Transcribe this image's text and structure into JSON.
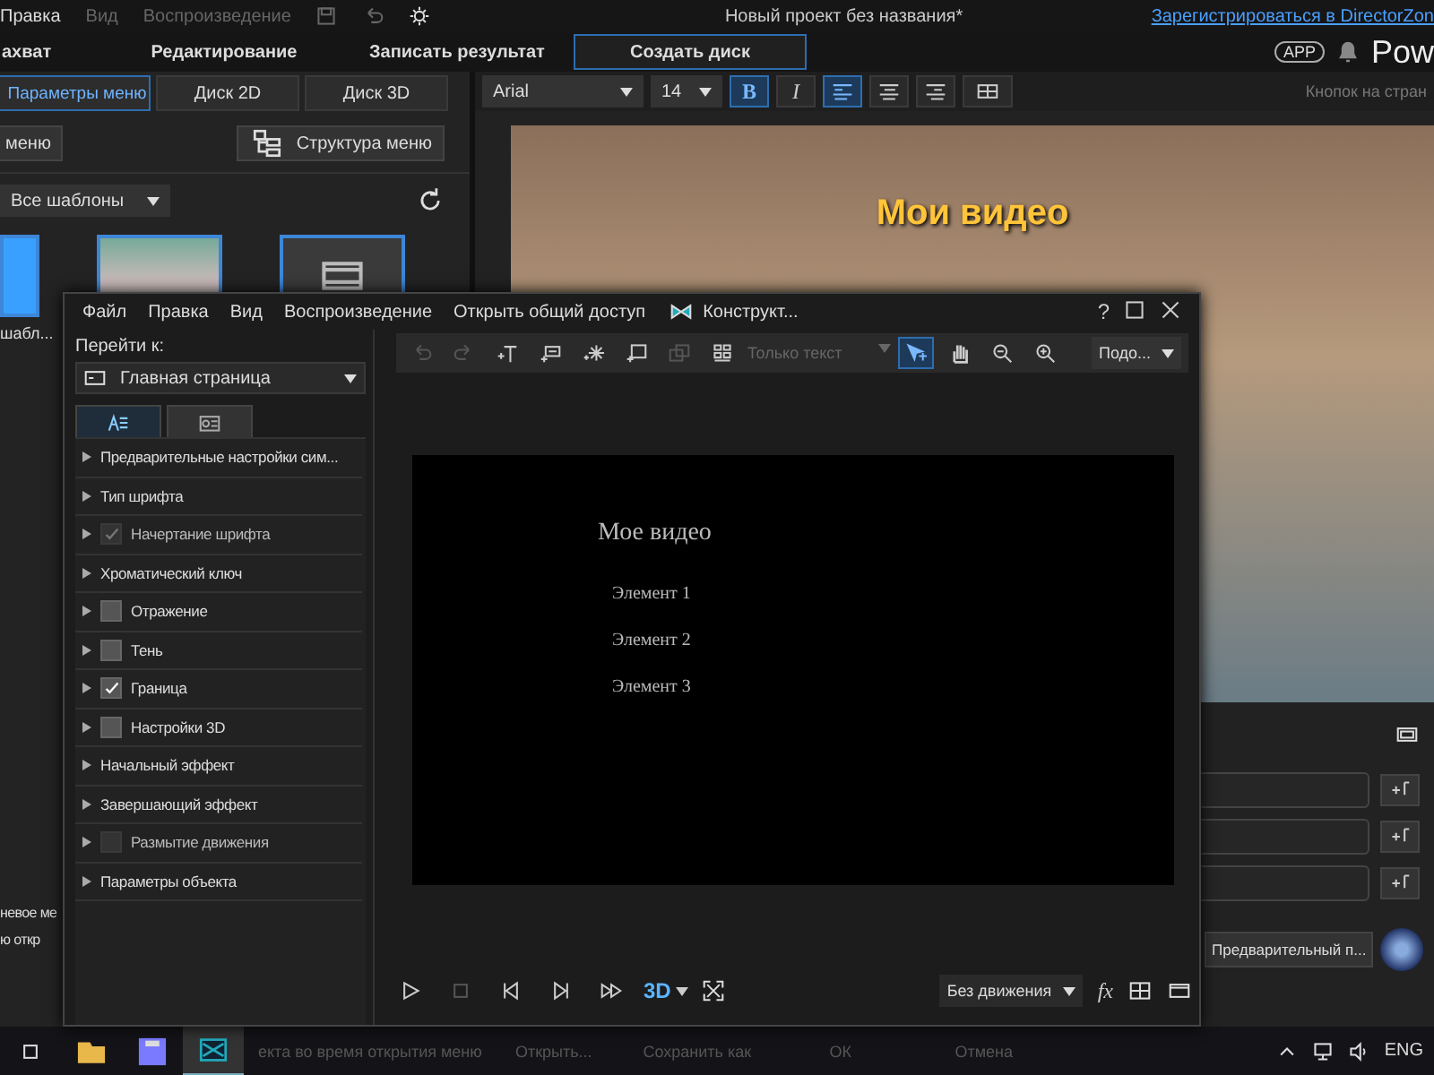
{
  "app": {
    "menu": [
      "Правка",
      "Вид",
      "Воспроизведение"
    ],
    "title": "Новый проект без названия*",
    "register_link": "Зарегистрироваться в DirectorZon",
    "app_badge": "APP",
    "brand": "Pow",
    "tabs": [
      {
        "label": "ахват",
        "selected": false
      },
      {
        "label": "Редактирование",
        "selected": false
      },
      {
        "label": "Записать результат",
        "selected": false
      },
      {
        "label": "Создать диск",
        "selected": true
      }
    ]
  },
  "left_panel": {
    "subtabs": [
      {
        "label": "Параметры меню",
        "selected": true
      },
      {
        "label": "Диск 2D",
        "selected": false
      },
      {
        "label": "Диск 3D",
        "selected": false
      }
    ],
    "menu_button": "меню",
    "structure_button": "Структура меню",
    "template_filter": "Все шаблоны",
    "thumbnail_caption": "шабл...",
    "thumbnails": [
      {
        "kind": "blank",
        "selected": true
      },
      {
        "kind": "photo",
        "selected": true
      },
      {
        "kind": "film",
        "selected": true
      }
    ],
    "side_texts": [
      "невое ме",
      "ю откр"
    ]
  },
  "editor": {
    "font": "Arial",
    "size": "14",
    "bold": true,
    "italic": false,
    "bold_label": "B",
    "italic_label": "I",
    "align": [
      {
        "kind": "left",
        "selected": true
      },
      {
        "kind": "center",
        "selected": false
      },
      {
        "kind": "right",
        "selected": false
      }
    ],
    "buttons_per_page": "Кнопок на стран",
    "preview_title": "Мои видео",
    "preview_button": "Предварительный п..."
  },
  "dialog": {
    "menu": [
      "Файл",
      "Правка",
      "Вид",
      "Воспроизведение",
      "Открыть общий доступ"
    ],
    "title": "Конструкт...",
    "help": "?",
    "goto_label": "Перейти к:",
    "goto_value": "Главная страница",
    "pane_tabs": [
      {
        "kind": "text",
        "selected": true
      },
      {
        "kind": "object",
        "selected": false
      }
    ],
    "properties": [
      {
        "label": "Предварительные настройки сим...",
        "kind": "plain"
      },
      {
        "label": "Тип шрифта",
        "kind": "plain"
      },
      {
        "label": "Начертание шрифта",
        "kind": "checkbox",
        "checked": true,
        "disabled": true
      },
      {
        "label": "Хроматический ключ",
        "kind": "plain"
      },
      {
        "label": "Отражение",
        "kind": "checkbox",
        "checked": false,
        "disabled": false
      },
      {
        "label": "Тень",
        "kind": "checkbox",
        "checked": false,
        "disabled": false
      },
      {
        "label": "Граница",
        "kind": "checkbox",
        "checked": true,
        "disabled": false
      },
      {
        "label": "Настройки 3D",
        "kind": "checkbox",
        "checked": false,
        "disabled": false
      },
      {
        "label": "Начальный эффект",
        "kind": "plain"
      },
      {
        "label": "Завершающий эффект",
        "kind": "plain"
      },
      {
        "label": "Размытие движения",
        "kind": "checkbox",
        "checked": false,
        "disabled": true
      },
      {
        "label": "Параметры объекта",
        "kind": "plain"
      }
    ],
    "toolbar": [
      {
        "kind": "undo",
        "disabled": true
      },
      {
        "kind": "redo",
        "disabled": true
      },
      {
        "kind": "add-text",
        "disabled": false
      },
      {
        "kind": "add-button",
        "disabled": false
      },
      {
        "kind": "add-particle",
        "disabled": false
      },
      {
        "kind": "add-frame",
        "disabled": false
      },
      {
        "kind": "layer",
        "disabled": true
      },
      {
        "kind": "grid",
        "disabled": false
      }
    ],
    "text_mode": {
      "label": "Только текст",
      "disabled": true
    },
    "tools": [
      {
        "kind": "select",
        "selected": true
      },
      {
        "kind": "hand",
        "selected": false
      },
      {
        "kind": "zoom-out",
        "selected": false
      },
      {
        "kind": "zoom-in",
        "selected": false
      }
    ],
    "zoom": "Подо...",
    "canvas": {
      "title": "Мое видео",
      "items": [
        "Элемент 1",
        "Элемент 2",
        "Элемент 3"
      ]
    },
    "playback": [
      {
        "kind": "play",
        "disabled": false
      },
      {
        "kind": "stop",
        "disabled": true
      },
      {
        "kind": "prev",
        "disabled": false
      },
      {
        "kind": "next",
        "disabled": false
      },
      {
        "kind": "fast-forward",
        "disabled": false
      }
    ],
    "mode_3d": "3D",
    "motion": "Без движения",
    "fx": "fx",
    "footer_hint": "екта во время открытия меню",
    "footer_buttons": [
      "Открыть...",
      "Сохранить как",
      "ОК",
      "Отмена"
    ]
  },
  "taskbar": {
    "lang": "ENG"
  }
}
